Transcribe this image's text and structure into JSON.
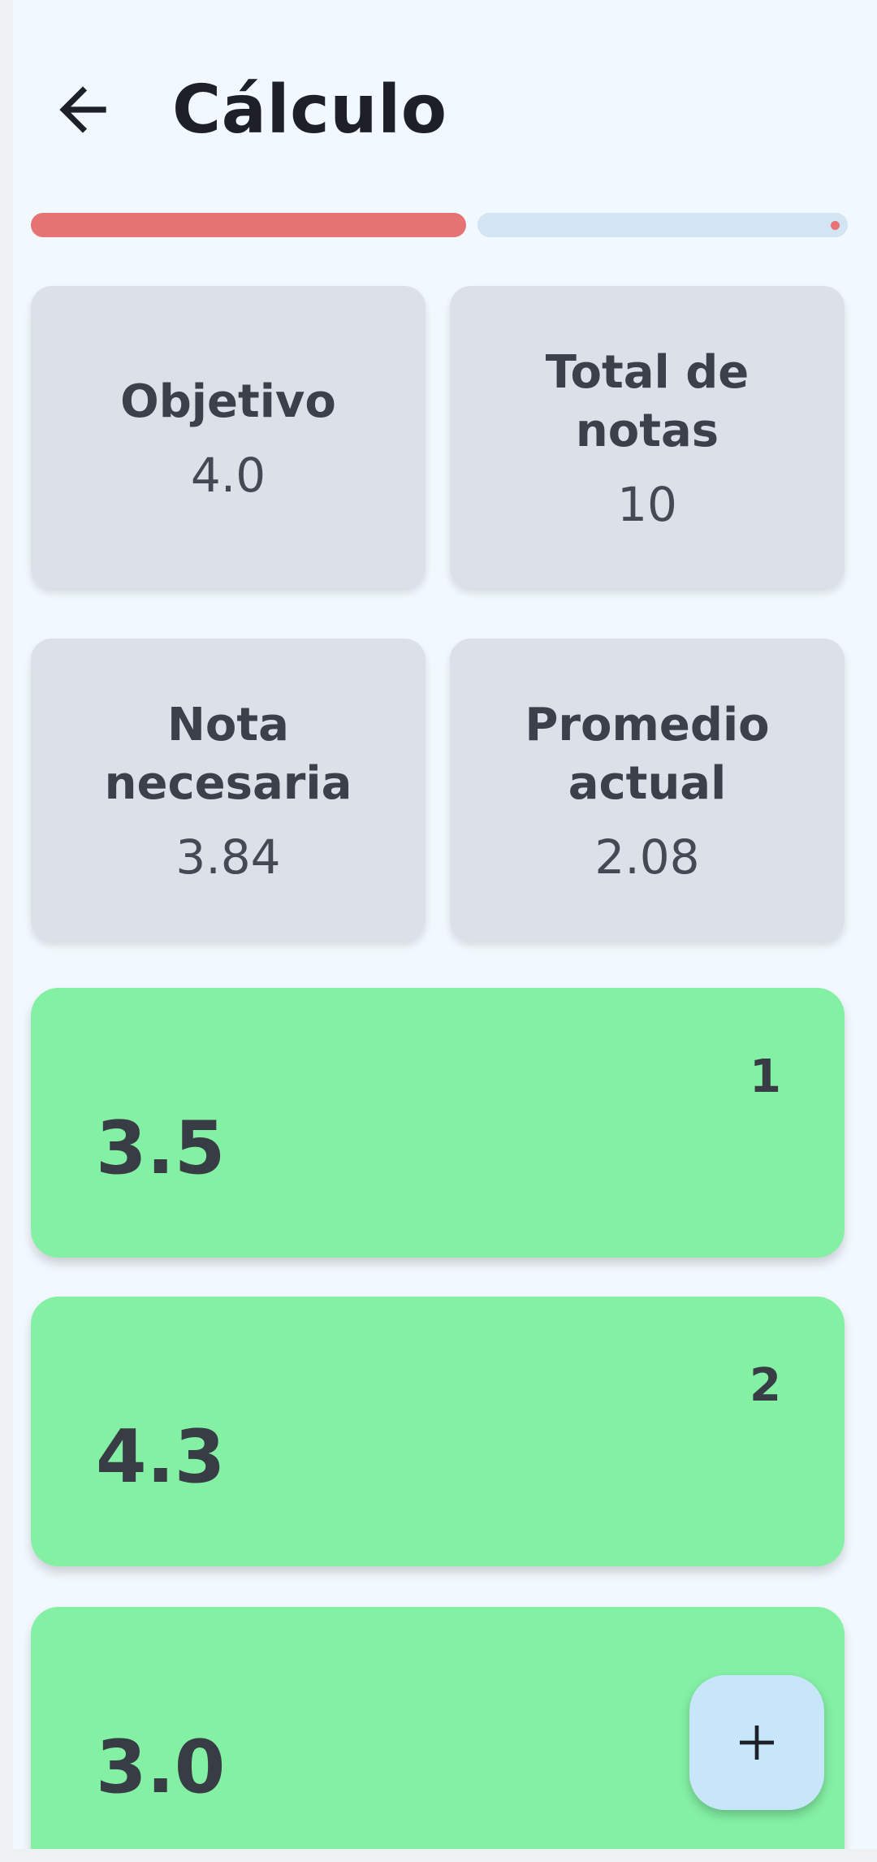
{
  "header": {
    "title": "Cálculo",
    "back_icon": "arrow-back-icon"
  },
  "progress": {
    "value_fraction": 0.53,
    "fill_color": "#e57373",
    "track_color": "#d3e4f2"
  },
  "stats": [
    {
      "label": "Objetivo",
      "value": "4.0"
    },
    {
      "label": "Total de notas",
      "value": "10"
    },
    {
      "label": "Nota necesaria",
      "value": "3.84"
    },
    {
      "label": "Promedio actual",
      "value": "2.08"
    }
  ],
  "grades": [
    {
      "value": "3.5",
      "index": "1"
    },
    {
      "value": "4.3",
      "index": "2"
    },
    {
      "value": "3.0",
      "index": ""
    }
  ],
  "fab": {
    "icon": "plus-icon"
  },
  "colors": {
    "background": "#f2f9fe",
    "stat_card": "#dce1e9",
    "grade_card": "#83f0a4",
    "fab": "#c8e6fa"
  }
}
